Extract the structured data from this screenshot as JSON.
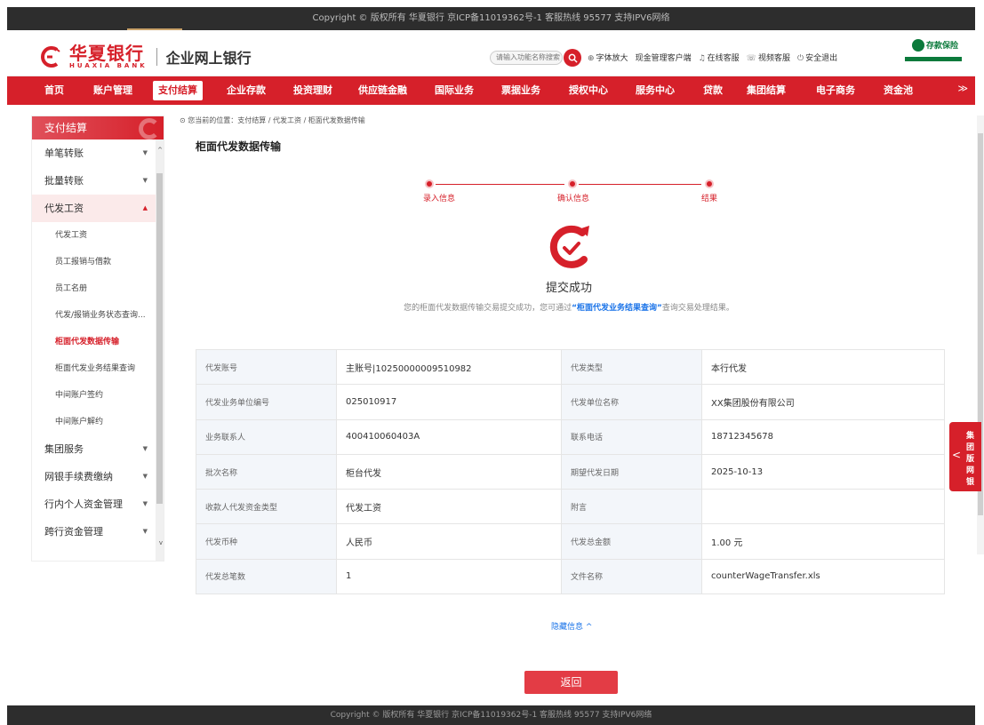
{
  "copyright": "Copyright © 版权所有 华夏银行 京ICP备11019362号-1 客服热线 95577 支持IPV6网络",
  "brand": {
    "name_cn": "华夏银行",
    "name_en": "HUAXIA BANK",
    "subtitle": "企业网上银行"
  },
  "header": {
    "search_placeholder": "请输入功能名称搜索",
    "links": [
      {
        "icon": "font-size-icon",
        "label": "字体放大"
      },
      {
        "icon": "",
        "label": "现金管理客户端"
      },
      {
        "icon": "headset-icon",
        "label": "在线客服"
      },
      {
        "icon": "video-icon",
        "label": "视频客服"
      },
      {
        "icon": "power-icon",
        "label": "安全退出"
      }
    ],
    "insurance_label": "存款保险"
  },
  "nav": {
    "items": [
      "首页",
      "账户管理",
      "支付结算",
      "企业存款",
      "投资理财",
      "供应链金融",
      "国际业务",
      "票据业务",
      "授权中心",
      "服务中心",
      "贷款",
      "集团结算",
      "电子商务",
      "资金池"
    ],
    "active": "支付结算",
    "more_icon": "double-chevron-down-icon"
  },
  "sidebar": {
    "title": "支付结算",
    "items": [
      {
        "label": "单笔转账"
      },
      {
        "label": "批量转账"
      },
      {
        "label": "代发工资",
        "open": true,
        "children": [
          "代发工资",
          "员工报销与借款",
          "员工名册",
          "代发/报销业务状态查询...",
          "柜面代发数据传输",
          "柜面代发业务结果查询",
          "中间账户签约",
          "中间账户解约"
        ],
        "active_child": "柜面代发数据传输"
      },
      {
        "label": "集团服务"
      },
      {
        "label": "网银手续费缴纳"
      },
      {
        "label": "行内个人资金管理"
      },
      {
        "label": "跨行资金管理"
      }
    ]
  },
  "breadcrumb": "您当前的位置：支付结算 / 代发工资 / 柜面代发数据传输",
  "page_title": "柜面代发数据传输",
  "steps": [
    "录入信息",
    "确认信息",
    "结果"
  ],
  "result": {
    "title": "提交成功",
    "desc_prefix": "您的柜面代发数据传输交易提交成功，您可通过",
    "desc_link": "“柜面代发业务结果查询”",
    "desc_suffix": "查询交易处理结果。"
  },
  "info_rows": [
    [
      {
        "k": "代发账号",
        "v": "主账号|10250000009510982"
      },
      {
        "k": "代发类型",
        "v": "本行代发"
      }
    ],
    [
      {
        "k": "代发业务单位编号",
        "v": "025010917"
      },
      {
        "k": "代发单位名称",
        "v": "XX集团股份有限公司"
      }
    ],
    [
      {
        "k": "业务联系人",
        "v": "400410060403A"
      },
      {
        "k": "联系电话",
        "v": "18712345678"
      }
    ],
    [
      {
        "k": "批次名称",
        "v": "柜台代发"
      },
      {
        "k": "期望代发日期",
        "v": "2025-10-13"
      }
    ],
    [
      {
        "k": "收款人代发资金类型",
        "v": "代发工资"
      },
      {
        "k": "附言",
        "v": ""
      }
    ],
    [
      {
        "k": "代发币种",
        "v": "人民币"
      },
      {
        "k": "代发总金额",
        "v": "1.00 元"
      }
    ],
    [
      {
        "k": "代发总笔数",
        "v": "1"
      },
      {
        "k": "文件名称",
        "v": "counterWageTransfer.xls"
      }
    ]
  ],
  "hide_info": "隐藏信息",
  "back_button": "返回",
  "float_tab": "集团版网银",
  "colors": {
    "brand_red": "#d6202a",
    "link_blue": "#1a73e8",
    "dark_bar": "#2d2d2d",
    "insurance_green": "#0b7a3b"
  }
}
